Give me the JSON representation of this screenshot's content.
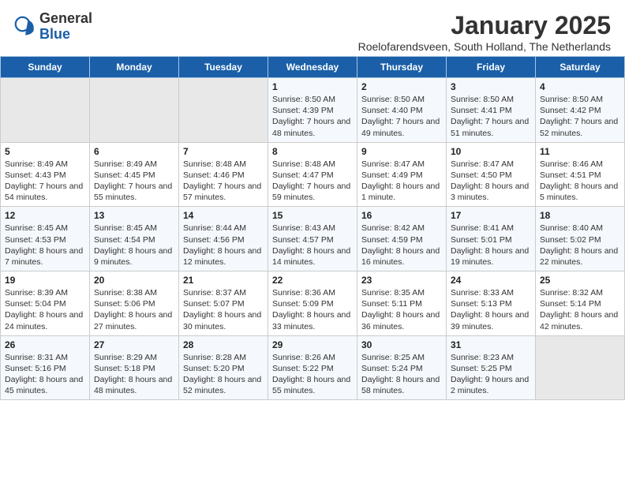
{
  "header": {
    "logo_general": "General",
    "logo_blue": "Blue",
    "month": "January 2025",
    "location": "Roelofarendsveen, South Holland, The Netherlands"
  },
  "days_of_week": [
    "Sunday",
    "Monday",
    "Tuesday",
    "Wednesday",
    "Thursday",
    "Friday",
    "Saturday"
  ],
  "weeks": [
    [
      {
        "day": "",
        "info": ""
      },
      {
        "day": "",
        "info": ""
      },
      {
        "day": "",
        "info": ""
      },
      {
        "day": "1",
        "info": "Sunrise: 8:50 AM\nSunset: 4:39 PM\nDaylight: 7 hours and 48 minutes."
      },
      {
        "day": "2",
        "info": "Sunrise: 8:50 AM\nSunset: 4:40 PM\nDaylight: 7 hours and 49 minutes."
      },
      {
        "day": "3",
        "info": "Sunrise: 8:50 AM\nSunset: 4:41 PM\nDaylight: 7 hours and 51 minutes."
      },
      {
        "day": "4",
        "info": "Sunrise: 8:50 AM\nSunset: 4:42 PM\nDaylight: 7 hours and 52 minutes."
      }
    ],
    [
      {
        "day": "5",
        "info": "Sunrise: 8:49 AM\nSunset: 4:43 PM\nDaylight: 7 hours and 54 minutes."
      },
      {
        "day": "6",
        "info": "Sunrise: 8:49 AM\nSunset: 4:45 PM\nDaylight: 7 hours and 55 minutes."
      },
      {
        "day": "7",
        "info": "Sunrise: 8:48 AM\nSunset: 4:46 PM\nDaylight: 7 hours and 57 minutes."
      },
      {
        "day": "8",
        "info": "Sunrise: 8:48 AM\nSunset: 4:47 PM\nDaylight: 7 hours and 59 minutes."
      },
      {
        "day": "9",
        "info": "Sunrise: 8:47 AM\nSunset: 4:49 PM\nDaylight: 8 hours and 1 minute."
      },
      {
        "day": "10",
        "info": "Sunrise: 8:47 AM\nSunset: 4:50 PM\nDaylight: 8 hours and 3 minutes."
      },
      {
        "day": "11",
        "info": "Sunrise: 8:46 AM\nSunset: 4:51 PM\nDaylight: 8 hours and 5 minutes."
      }
    ],
    [
      {
        "day": "12",
        "info": "Sunrise: 8:45 AM\nSunset: 4:53 PM\nDaylight: 8 hours and 7 minutes."
      },
      {
        "day": "13",
        "info": "Sunrise: 8:45 AM\nSunset: 4:54 PM\nDaylight: 8 hours and 9 minutes."
      },
      {
        "day": "14",
        "info": "Sunrise: 8:44 AM\nSunset: 4:56 PM\nDaylight: 8 hours and 12 minutes."
      },
      {
        "day": "15",
        "info": "Sunrise: 8:43 AM\nSunset: 4:57 PM\nDaylight: 8 hours and 14 minutes."
      },
      {
        "day": "16",
        "info": "Sunrise: 8:42 AM\nSunset: 4:59 PM\nDaylight: 8 hours and 16 minutes."
      },
      {
        "day": "17",
        "info": "Sunrise: 8:41 AM\nSunset: 5:01 PM\nDaylight: 8 hours and 19 minutes."
      },
      {
        "day": "18",
        "info": "Sunrise: 8:40 AM\nSunset: 5:02 PM\nDaylight: 8 hours and 22 minutes."
      }
    ],
    [
      {
        "day": "19",
        "info": "Sunrise: 8:39 AM\nSunset: 5:04 PM\nDaylight: 8 hours and 24 minutes."
      },
      {
        "day": "20",
        "info": "Sunrise: 8:38 AM\nSunset: 5:06 PM\nDaylight: 8 hours and 27 minutes."
      },
      {
        "day": "21",
        "info": "Sunrise: 8:37 AM\nSunset: 5:07 PM\nDaylight: 8 hours and 30 minutes."
      },
      {
        "day": "22",
        "info": "Sunrise: 8:36 AM\nSunset: 5:09 PM\nDaylight: 8 hours and 33 minutes."
      },
      {
        "day": "23",
        "info": "Sunrise: 8:35 AM\nSunset: 5:11 PM\nDaylight: 8 hours and 36 minutes."
      },
      {
        "day": "24",
        "info": "Sunrise: 8:33 AM\nSunset: 5:13 PM\nDaylight: 8 hours and 39 minutes."
      },
      {
        "day": "25",
        "info": "Sunrise: 8:32 AM\nSunset: 5:14 PM\nDaylight: 8 hours and 42 minutes."
      }
    ],
    [
      {
        "day": "26",
        "info": "Sunrise: 8:31 AM\nSunset: 5:16 PM\nDaylight: 8 hours and 45 minutes."
      },
      {
        "day": "27",
        "info": "Sunrise: 8:29 AM\nSunset: 5:18 PM\nDaylight: 8 hours and 48 minutes."
      },
      {
        "day": "28",
        "info": "Sunrise: 8:28 AM\nSunset: 5:20 PM\nDaylight: 8 hours and 52 minutes."
      },
      {
        "day": "29",
        "info": "Sunrise: 8:26 AM\nSunset: 5:22 PM\nDaylight: 8 hours and 55 minutes."
      },
      {
        "day": "30",
        "info": "Sunrise: 8:25 AM\nSunset: 5:24 PM\nDaylight: 8 hours and 58 minutes."
      },
      {
        "day": "31",
        "info": "Sunrise: 8:23 AM\nSunset: 5:25 PM\nDaylight: 9 hours and 2 minutes."
      },
      {
        "day": "",
        "info": ""
      }
    ]
  ]
}
